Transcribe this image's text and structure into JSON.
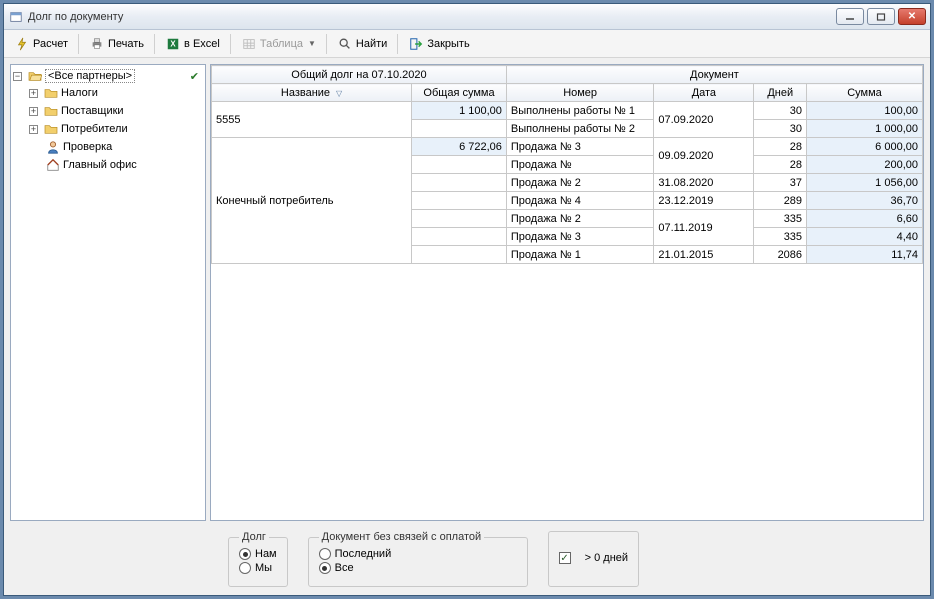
{
  "window": {
    "title": "Долг по документу"
  },
  "toolbar": {
    "calc": "Расчет",
    "print": "Печать",
    "excel": "в Excel",
    "table": "Таблица",
    "find": "Найти",
    "close": "Закрыть"
  },
  "tree": {
    "root": "<Все партнеры>",
    "items": [
      {
        "label": "Налоги",
        "expandable": true
      },
      {
        "label": "Поставщики",
        "expandable": true
      },
      {
        "label": "Потребители",
        "expandable": true
      },
      {
        "label": "Проверка",
        "icon": "person"
      },
      {
        "label": "Главный офис",
        "icon": "home"
      }
    ]
  },
  "grid": {
    "header_total": "Общий долг на 07.10.2020",
    "header_doc": "Документ",
    "col_name": "Название",
    "col_total": "Общая сумма",
    "col_num": "Номер",
    "col_date": "Дата",
    "col_days": "Дней",
    "col_sum": "Сумма",
    "g1_name": "5555",
    "g1_total": "1 100,00",
    "g1_r1_doc": "Выполнены работы № 1",
    "g1_r1_date": "07.09.2020",
    "g1_r1_days": "30",
    "g1_r1_sum": "100,00",
    "g1_r2_doc": "Выполнены работы № 2",
    "g1_r2_days": "30",
    "g1_r2_sum": "1 000,00",
    "g2_name": "Конечный потребитель",
    "g2_total": "6 722,06",
    "g2_r1_doc": "Продажа № 3",
    "g2_r1_date": "09.09.2020",
    "g2_r1_days": "28",
    "g2_r1_sum": "6 000,00",
    "g2_r2_doc": "Продажа №",
    "g2_r2_days": "28",
    "g2_r2_sum": "200,00",
    "g2_r3_doc": "Продажа № 2",
    "g2_r3_date": "31.08.2020",
    "g2_r3_days": "37",
    "g2_r3_sum": "1 056,00",
    "g2_r4_doc": "Продажа № 4",
    "g2_r4_date": "23.12.2019",
    "g2_r4_days": "289",
    "g2_r4_sum": "36,70",
    "g2_r5_doc": "Продажа № 2",
    "g2_r5_date": "07.11.2019",
    "g2_r5_days": "335",
    "g2_r5_sum": "6,60",
    "g2_r6_doc": "Продажа № 3",
    "g2_r6_days": "335",
    "g2_r6_sum": "4,40",
    "g2_r7_doc": "Продажа № 1",
    "g2_r7_date": "21.01.2015",
    "g2_r7_days": "2086",
    "g2_r7_sum": "11,74"
  },
  "footer": {
    "debt_legend": "Долг",
    "debt_nam": "Нам",
    "debt_my": "Мы",
    "docopt_legend": "Документ без связей с оплатой",
    "docopt_last": "Последний",
    "docopt_all": "Все",
    "days_label": "> 0 дней"
  }
}
